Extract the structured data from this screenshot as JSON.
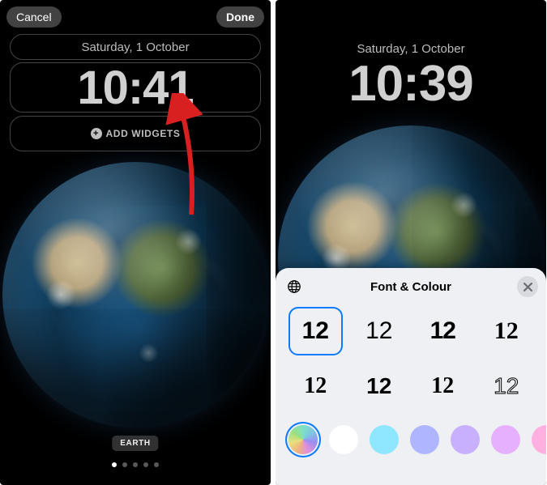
{
  "left": {
    "cancel": "Cancel",
    "done": "Done",
    "date": "Saturday, 1 October",
    "time": "10:41",
    "add_widgets": "ADD WIDGETS",
    "wallpaper_label": "EARTH",
    "page_count": 5,
    "active_page": 0
  },
  "right": {
    "date": "Saturday, 1 October",
    "time": "10:39"
  },
  "sheet": {
    "title": "Font & Colour",
    "sample": "12",
    "fonts": 8,
    "selected_font": 0,
    "colors": [
      "rainbow",
      "#ffffff",
      "#8ee6ff",
      "#b0b5ff",
      "#c9b0ff",
      "#e7b0ff",
      "#ffb0e0"
    ],
    "selected_color": 0
  }
}
